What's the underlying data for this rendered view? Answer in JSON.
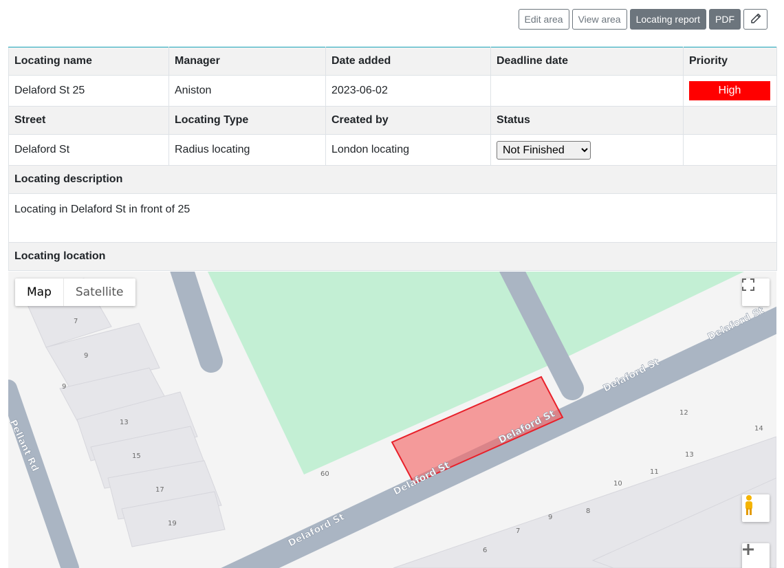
{
  "toolbar": {
    "edit_area": "Edit area",
    "view_area": "View area",
    "locating_report": "Locating report",
    "pdf": "PDF",
    "edit_icon": "pencil-icon"
  },
  "table": {
    "headers1": [
      "Locating name",
      "Manager",
      "Date added",
      "Deadline date",
      "Priority"
    ],
    "row1": {
      "locating_name": "Delaford St 25",
      "manager": "Aniston",
      "date_added": "2023-06-02",
      "deadline_date": "",
      "priority": "High"
    },
    "headers2": [
      "Street",
      "Locating Type",
      "Created by",
      "Status"
    ],
    "row2": {
      "street": "Delaford St",
      "locating_type": "Radius locating",
      "created_by": "London locating",
      "status": "Not Finished"
    },
    "description_header": "Locating description",
    "description": "Locating in Delaford St in front of 25",
    "location_header": "Locating location"
  },
  "map": {
    "type_map": "Map",
    "type_satellite": "Satellite",
    "streets": {
      "delaford_top": "Delaford St",
      "delaford_mid": "Delaford St",
      "delaford_polygon": "Delaford St",
      "delaford_lower": "Delaford St",
      "delaford_bottom": "Delaford St",
      "pellant": "Pellant Rd"
    },
    "house_numbers_left": [
      "7",
      "9",
      "9",
      "13",
      "15",
      "17",
      "19",
      "60"
    ],
    "house_numbers_right": [
      "12",
      "14",
      "13",
      "11",
      "10",
      "9",
      "8",
      "7",
      "6"
    ],
    "colors": {
      "road": "#aab5c3",
      "park": "#c3efd4",
      "building": "#e8e8ec",
      "area_fill": "#f46a6a",
      "area_stroke": "#e8202a"
    },
    "controls": [
      "fullscreen-icon",
      "pegman-icon",
      "zoom-in-icon"
    ]
  }
}
